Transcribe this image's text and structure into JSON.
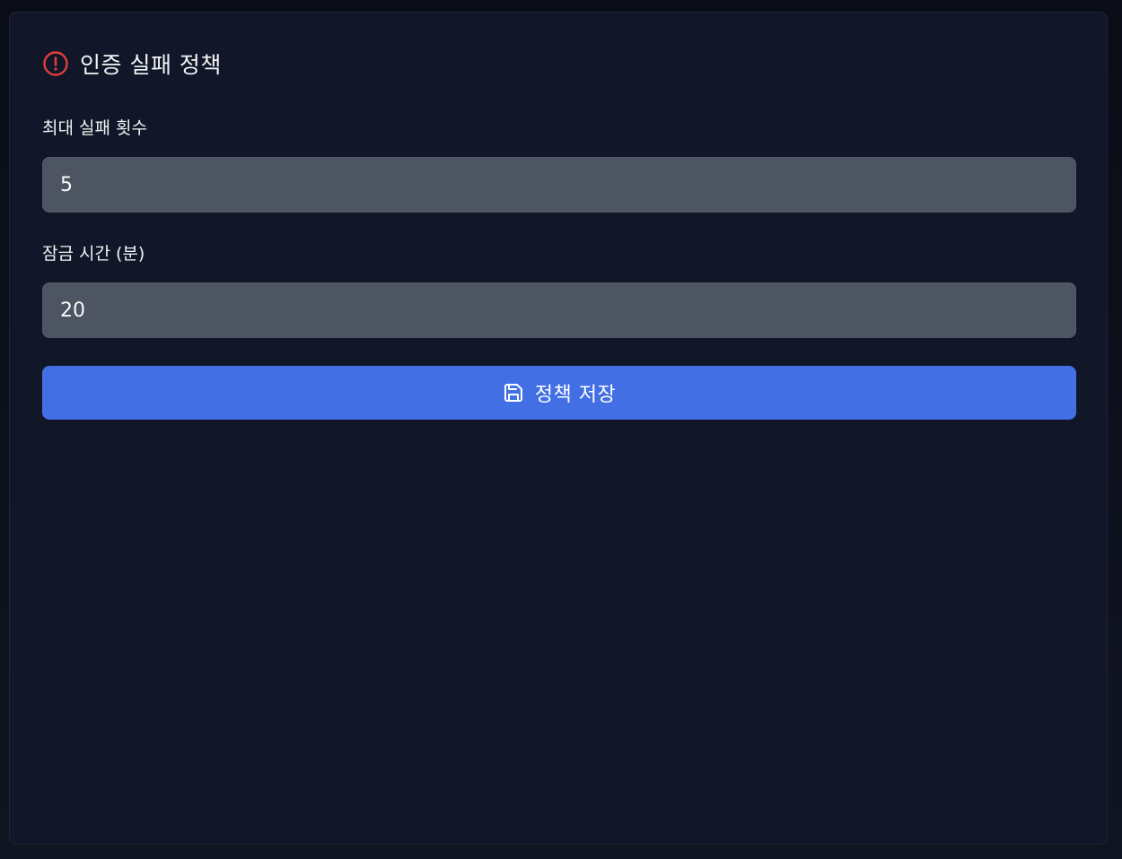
{
  "panel": {
    "title": "인증 실패 정책",
    "title_icon": "alert-circle-icon",
    "title_icon_color": "#e03e3e"
  },
  "fields": [
    {
      "label": "최대 실패 횟수",
      "value": "5"
    },
    {
      "label": "잠금 시간 (분)",
      "value": "20"
    }
  ],
  "save_button": {
    "label": "정책 저장",
    "icon": "save-icon",
    "color": "#4270e4"
  }
}
